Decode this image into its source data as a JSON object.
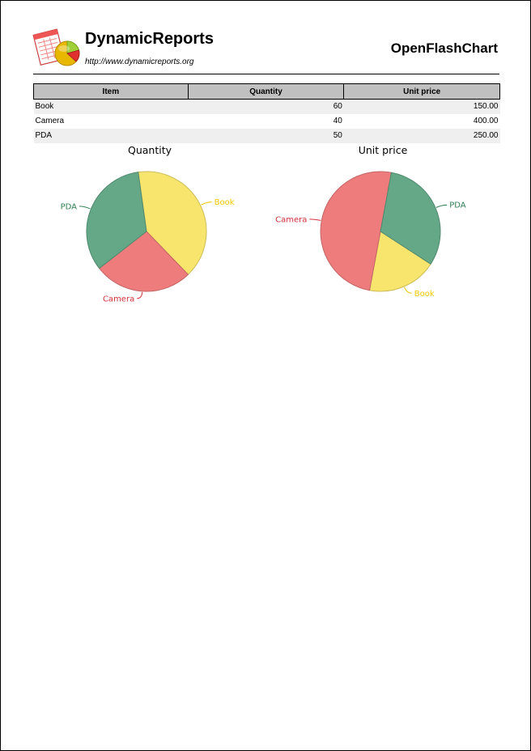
{
  "header": {
    "brand": "DynamicReports",
    "url": "http://www.dynamicreports.org",
    "title": "OpenFlashChart"
  },
  "table": {
    "columns": [
      "Item",
      "Quantity",
      "Unit price"
    ],
    "rows": [
      {
        "item": "Book",
        "quantity": "60",
        "unit_price": "150.00"
      },
      {
        "item": "Camera",
        "quantity": "40",
        "unit_price": "400.00"
      },
      {
        "item": "PDA",
        "quantity": "50",
        "unit_price": "250.00"
      }
    ]
  },
  "colors": {
    "Book": "#fdea6f",
    "Camera": "#f47f7f",
    "PDA": "#66ab8b",
    "Book_label": "#f0c800",
    "Camera_label": "#d0303a",
    "PDA_label": "#2e7d52"
  },
  "chart_data": [
    {
      "type": "pie",
      "title": "Quantity",
      "categories": [
        "Book",
        "Camera",
        "PDA"
      ],
      "values": [
        60,
        40,
        50
      ]
    },
    {
      "type": "pie",
      "title": "Unit price",
      "categories": [
        "Book",
        "Camera",
        "PDA"
      ],
      "values": [
        150.0,
        400.0,
        250.0
      ]
    }
  ]
}
